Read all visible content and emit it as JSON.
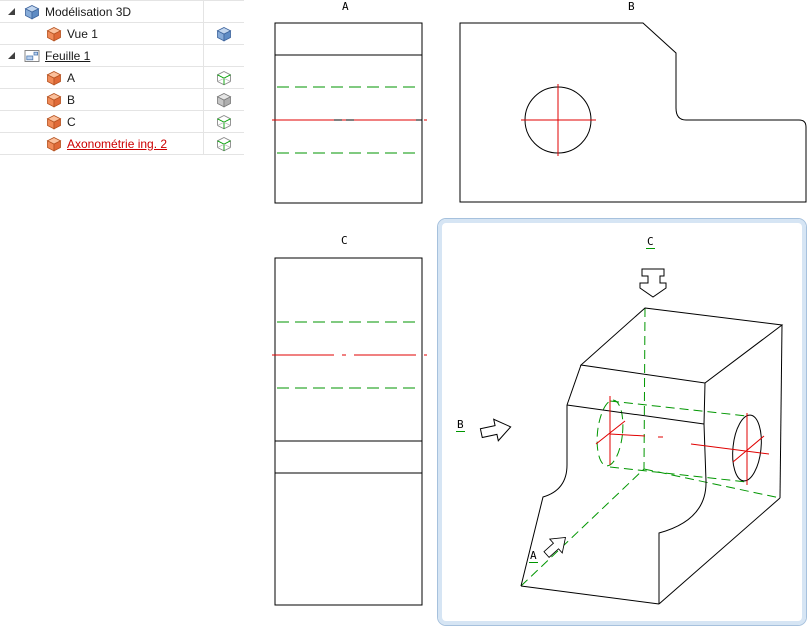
{
  "panel": {
    "rows": [
      {
        "label": "Modélisation 3D"
      },
      {
        "label": "Vue 1"
      },
      {
        "label": "Feuille 1"
      },
      {
        "label": "A"
      },
      {
        "label": "B"
      },
      {
        "label": "C"
      },
      {
        "label": "Axonométrie ing. 2"
      }
    ]
  },
  "views": {
    "a": {
      "title": "A"
    },
    "b": {
      "title": "B"
    },
    "c": {
      "title": "C"
    },
    "axon": {
      "title": "C",
      "dir_a": "A",
      "dir_b": "B",
      "selected": true
    }
  },
  "colors": {
    "hidden_line": "#009600",
    "center_line": "#e00000",
    "drawing_line": "#000000",
    "selection_border": "#a6c1dd",
    "selection_border_inner": "#d6e5f4",
    "tree_grid": "#e4e4e4",
    "renamed_text": "#cc0000"
  }
}
